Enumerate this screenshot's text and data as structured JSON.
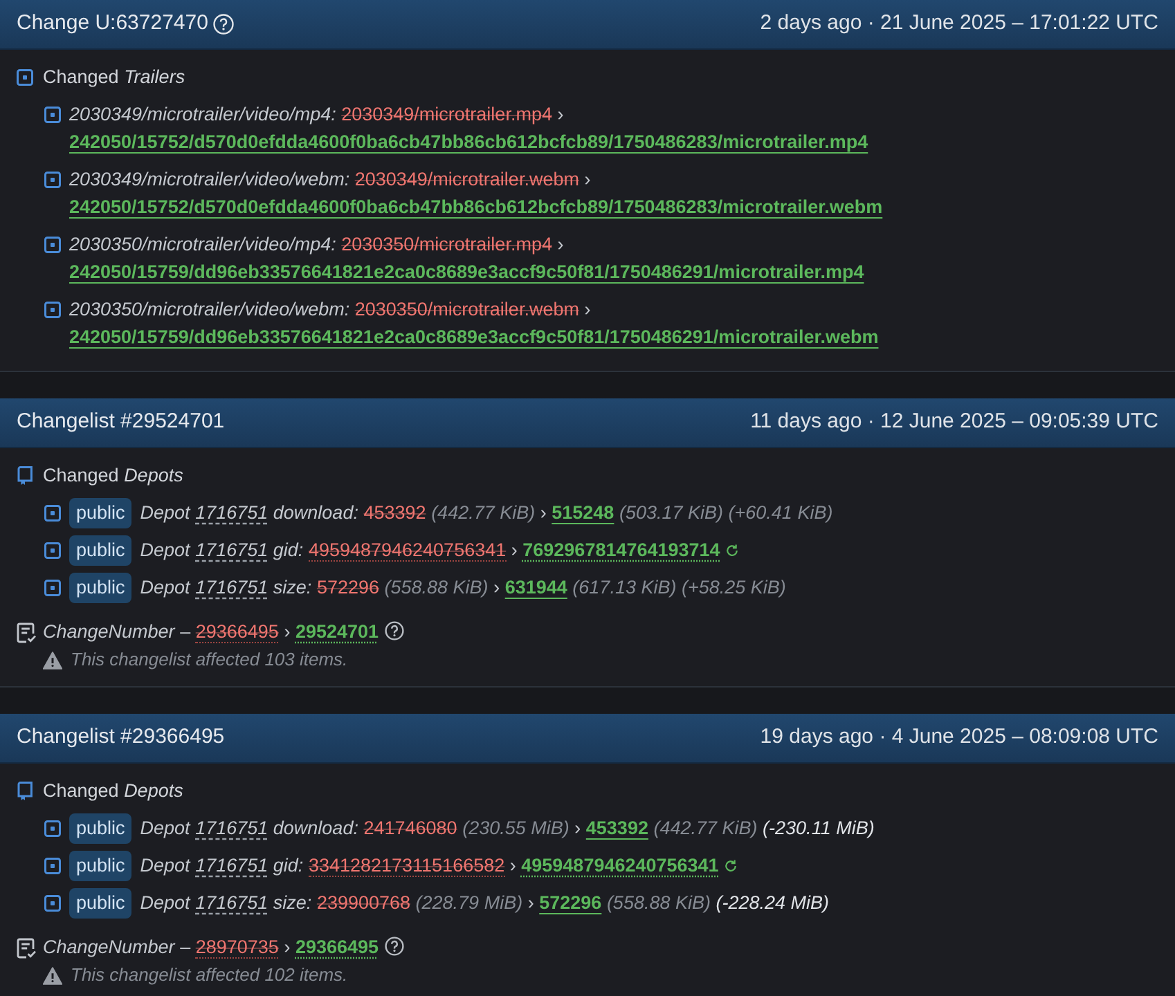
{
  "changes": [
    {
      "title": "Change U:63727470",
      "title_help": true,
      "timestamp": "2 days ago · 21 June 2025 – 17:01:22 UTC",
      "sections": [
        {
          "kind": "trailers",
          "title": "Changed *Trailers*",
          "items": [
            {
              "key": "2030349/microtrailer/video/mp4:",
              "old": "2030349/microtrailer.mp4",
              "separator": "›",
              "new": "242050/15752/d570d0efdda4600f0ba6cb47bb86cb612bcfcb89/1750486283/microtrailer.mp4"
            },
            {
              "key": "2030349/microtrailer/video/webm:",
              "old": "2030349/microtrailer.webm",
              "separator": "›",
              "new": "242050/15752/d570d0efdda4600f0ba6cb47bb86cb612bcfcb89/1750486283/microtrailer.webm"
            },
            {
              "key": "2030350/microtrailer/video/mp4:",
              "old": "2030350/microtrailer.mp4",
              "separator": "›",
              "new": "242050/15759/dd96eb33576641821e2ca0c8689e3accf9c50f81/1750486291/microtrailer.mp4"
            },
            {
              "key": "2030350/microtrailer/video/webm:",
              "old": "2030350/microtrailer.webm",
              "separator": "›",
              "new": "242050/15759/dd96eb33576641821e2ca0c8689e3accf9c50f81/1750486291/microtrailer.webm"
            }
          ]
        }
      ]
    },
    {
      "title": "Changelist #29524701",
      "title_help": false,
      "timestamp": "11 days ago · 12 June 2025 – 09:05:39 UTC",
      "sections": [
        {
          "kind": "depots",
          "title": "Changed *Depots*",
          "items": [
            {
              "kind": "size",
              "badge": "public",
              "label": "Depot",
              "depot_id": "1716751",
              "field": "download:",
              "old": "453392",
              "old_size": "(442.77 KiB)",
              "separator": "›",
              "new": "515248",
              "new_size": "(503.17 KiB)",
              "diff": "(+60.41 KiB)",
              "diff_highlighted": false
            },
            {
              "kind": "hash",
              "badge": "public",
              "label": "Depot",
              "depot_id": "1716751",
              "field": "gid:",
              "old": "4959487946240756341",
              "separator": "›",
              "new": "7692967814764193714"
            },
            {
              "kind": "size",
              "badge": "public",
              "label": "Depot",
              "depot_id": "1716751",
              "field": "size:",
              "old": "572296",
              "old_size": "(558.88 KiB)",
              "separator": "›",
              "new": "631944",
              "new_size": "(617.13 KiB)",
              "diff": "(+58.25 KiB)",
              "diff_highlighted": false
            }
          ]
        }
      ],
      "change_number": {
        "label": "ChangeNumber",
        "dash": "–",
        "old": "29366495",
        "separator": "›",
        "new": "29524701"
      },
      "note": "This changelist affected 103 items."
    },
    {
      "title": "Changelist #29366495",
      "title_help": false,
      "timestamp": "19 days ago · 4 June 2025 – 08:09:08 UTC",
      "sections": [
        {
          "kind": "depots",
          "title": "Changed *Depots*",
          "items": [
            {
              "kind": "size",
              "badge": "public",
              "label": "Depot",
              "depot_id": "1716751",
              "field": "download:",
              "old": "241746080",
              "old_size": "(230.55 MiB)",
              "separator": "›",
              "new": "453392",
              "new_size": "(442.77 KiB)",
              "diff": "(-230.11 MiB)",
              "diff_highlighted": true
            },
            {
              "kind": "hash",
              "badge": "public",
              "label": "Depot",
              "depot_id": "1716751",
              "field": "gid:",
              "old": "3341282173115166582",
              "separator": "›",
              "new": "4959487946240756341"
            },
            {
              "kind": "size",
              "badge": "public",
              "label": "Depot",
              "depot_id": "1716751",
              "field": "size:",
              "old": "239900768",
              "old_size": "(228.79 MiB)",
              "separator": "›",
              "new": "572296",
              "new_size": "(558.88 KiB)",
              "diff": "(-228.24 MiB)",
              "diff_highlighted": true
            }
          ]
        }
      ],
      "change_number": {
        "label": "ChangeNumber",
        "dash": "–",
        "old": "28970735",
        "separator": "›",
        "new": "29366495"
      },
      "note": "This changelist affected 102 items."
    }
  ]
}
